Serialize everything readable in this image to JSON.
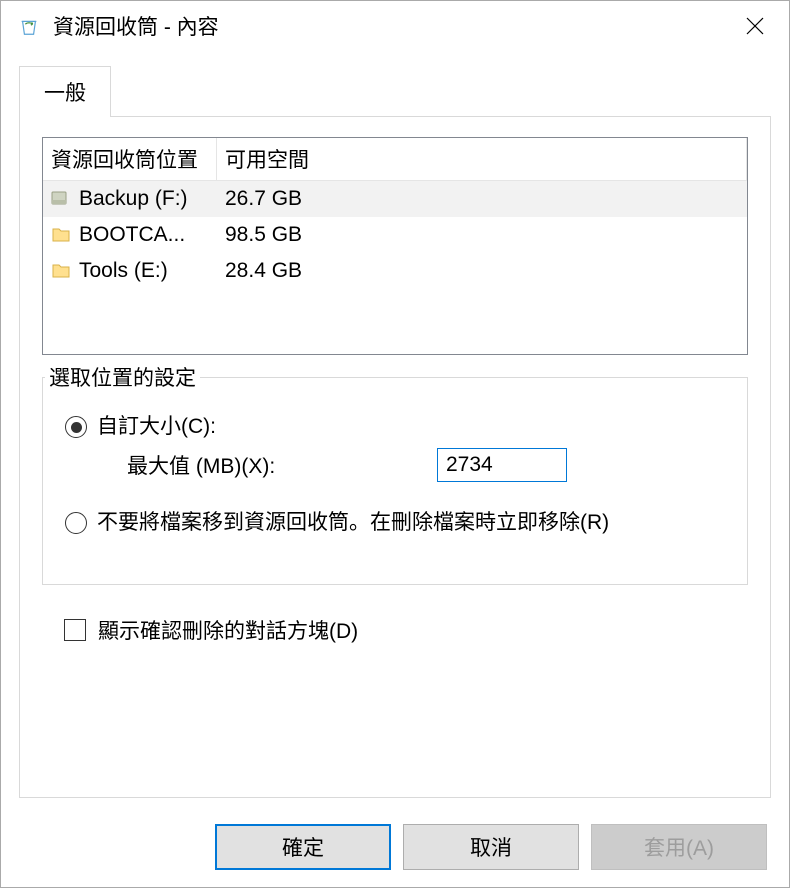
{
  "window": {
    "title": "資源回收筒 - 內容"
  },
  "tabs": {
    "general": "一般"
  },
  "listview": {
    "header_location": "資源回收筒位置",
    "header_space": "可用空間",
    "rows": [
      {
        "name": "Backup (F:)",
        "space": "26.7 GB",
        "selected": true,
        "icon": "drive"
      },
      {
        "name": "BOOTCA...",
        "space": "98.5 GB",
        "selected": false,
        "icon": "folder"
      },
      {
        "name": "Tools (E:)",
        "space": "28.4 GB",
        "selected": false,
        "icon": "folder"
      }
    ]
  },
  "settings": {
    "group_title": "選取位置的設定",
    "custom_size_label": "自訂大小(C):",
    "max_label": "最大值 (MB)(X):",
    "max_value": "2734",
    "remove_immediately_label": "不要將檔案移到資源回收筒。在刪除檔案時立即移除(R)",
    "selected_option": "custom"
  },
  "confirm": {
    "label": "顯示確認刪除的對話方塊(D)",
    "checked": false
  },
  "buttons": {
    "ok": "確定",
    "cancel": "取消",
    "apply": "套用(A)"
  }
}
